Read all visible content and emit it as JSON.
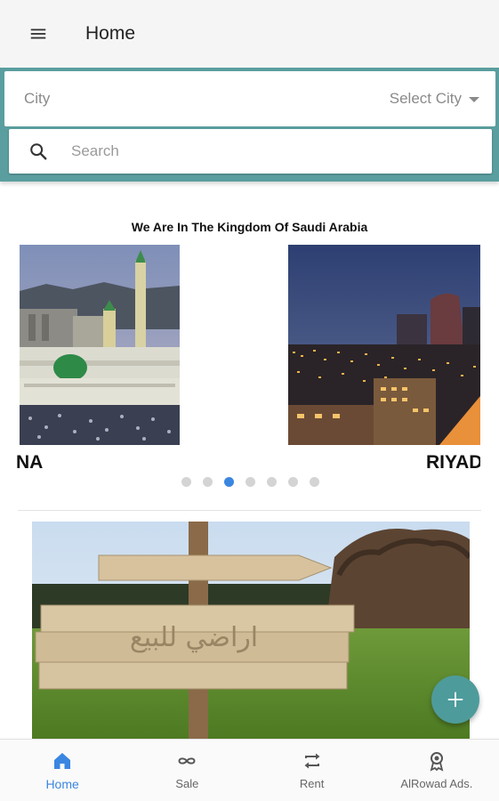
{
  "appbar": {
    "title": "Home",
    "menu_icon": "hamburger-menu-icon"
  },
  "filters": {
    "city_label": "City",
    "city_select_value": "Select City",
    "search_placeholder": "Search"
  },
  "carousel": {
    "title": "We Are In The Kingdom Of Saudi Arabia",
    "slides": [
      {
        "label": "NA",
        "image": "medina-mosque-photo"
      },
      {
        "label": "RIYAD",
        "image": "riyadh-skyline-photo"
      }
    ],
    "dot_count": 7,
    "active_dot": 3
  },
  "banner": {
    "image": "land-for-sale-sign-photo",
    "sign_text": "اراضي للبيع"
  },
  "fab": {
    "icon": "plus-icon"
  },
  "bottom_nav": {
    "items": [
      {
        "label": "Home",
        "icon": "home-icon",
        "active": true
      },
      {
        "label": "Sale",
        "icon": "infinity-icon",
        "active": false
      },
      {
        "label": "Rent",
        "icon": "repeat-icon",
        "active": false
      },
      {
        "label": "AlRowad Ads.",
        "icon": "award-icon",
        "active": false
      }
    ]
  },
  "colors": {
    "teal": "#5a9e9f",
    "active_blue": "#3b86e0",
    "fab": "#4e9b9b"
  }
}
